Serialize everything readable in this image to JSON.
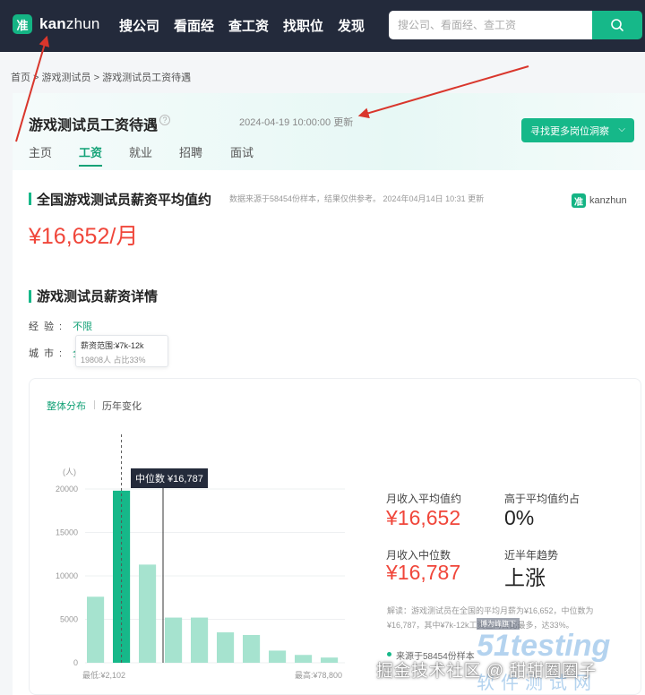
{
  "header": {
    "logo_char": "准",
    "brand_bold": "kan",
    "brand_rest": "zhun",
    "nav": [
      "搜公司",
      "看面经",
      "查工资",
      "找职位",
      "发现"
    ],
    "search_placeholder": "搜公司、看面经、查工资",
    "search_icon": "search-icon"
  },
  "breadcrumb": "首页 > 游戏测试员 > 游戏测试员工资待遇",
  "page": {
    "title": "游戏测试员工资待遇",
    "help_mark": "?",
    "updated": "2024-04-19 10:00:00 更新",
    "more_button": "寻找更多岗位洞察",
    "more_chevron": "⌵",
    "tabs": [
      "主页",
      "工资",
      "就业",
      "招聘",
      "面试"
    ],
    "active_tab": "工资"
  },
  "avg_section": {
    "title": "全国游戏测试员薪资平均值约",
    "note": "数据来源于58454份样本，结果仅供参考。   2024年04月14日 10:31 更新",
    "value": "¥16,652/月"
  },
  "detail_section": {
    "title": "游戏测试员薪资详情",
    "brand_logo": "准",
    "brand_name": "kanzhun",
    "experience_label": "经验:",
    "experience_value": "不限",
    "city_label": "城市:",
    "city_value": "全国",
    "subtabs": [
      "整体分布",
      "历年变化"
    ],
    "tooltip_range": "薪资范围:¥7k-12k",
    "tooltip_share": "19808人  占比33%",
    "median_label": "中位数 ¥16,787",
    "min_label": "最低:¥2,102",
    "max_label": "最高:¥78,800"
  },
  "chart_data": {
    "type": "bar",
    "ylabel": "(人)",
    "ylim": [
      0,
      20000
    ],
    "yticks": [
      "0",
      "5000",
      "10000",
      "15000",
      "20000"
    ],
    "values": [
      7600,
      19808,
      11300,
      5200,
      5200,
      3500,
      3200,
      1400,
      900,
      600
    ],
    "highlight_index": 1,
    "median_position": 3,
    "colors": {
      "bar": "#a6e3cf",
      "highlight": "#16b889",
      "median_line": "#333333"
    }
  },
  "stats": {
    "avg_label": "月收入平均值约",
    "avg_value": "¥16,652",
    "above_label": "高于平均值约占",
    "above_value": "0%",
    "median_label": "月收入中位数",
    "median_value": "¥16,787",
    "trend_label": "近半年趋势",
    "trend_value": "上涨",
    "explain": "解读：游戏测试员在全国的平均月薪为¥16,652，中位数为¥16,787，其中¥7k-12k工资区间占比最多，达33%。",
    "source_line": "来源于58454份样本"
  },
  "overlays": {
    "wm_a": "博为峰旗下",
    "watermark": "掘金技术社区 @ 甜甜圈圈子",
    "testing": "51testing",
    "testing_sub": "软件测试网"
  },
  "colors": {
    "accent": "#16b889",
    "price_red": "#f0463a",
    "header_bg": "#232a3b",
    "arrow_red": "#d9362c"
  }
}
